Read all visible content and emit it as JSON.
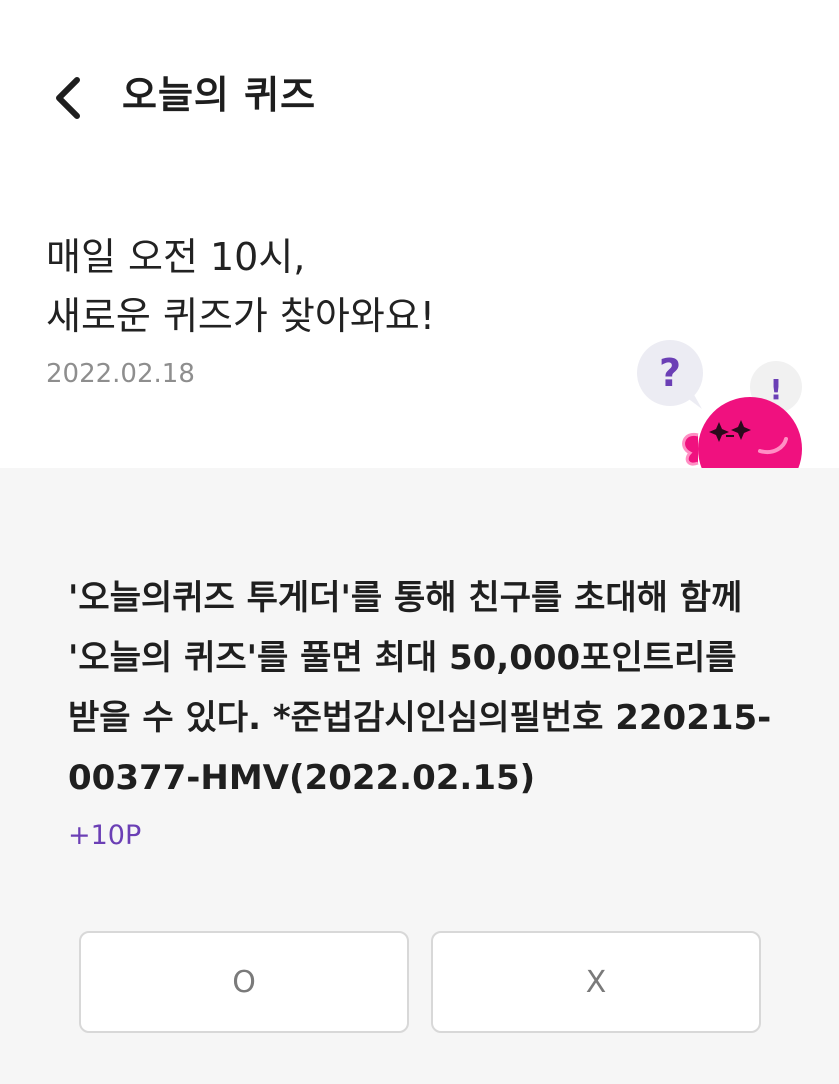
{
  "header": {
    "title": "오늘의 퀴즈"
  },
  "intro": {
    "line1": "매일 오전 10시,",
    "line2": "새로운 퀴즈가 찾아와요!",
    "date": "2022.02.18"
  },
  "mascot": {
    "bubble_left": "?",
    "bubble_right": "!",
    "body_color": "#f0117f",
    "accent_color": "#6b3fb5"
  },
  "quiz": {
    "question": "'오늘의퀴즈 투게더'를 통해 친구를 초대해 함께 '오늘의 퀴즈'를 풀면 최대 50,000포인트리를 받을 수 있다. *준법감시인심의필번호 220215-00377-HMV(2022.02.15)",
    "reward": "+10P",
    "answers": {
      "o": "O",
      "x": "X"
    }
  },
  "colors": {
    "accent": "#6b3fb5",
    "panel_bg": "#f6f6f6"
  }
}
